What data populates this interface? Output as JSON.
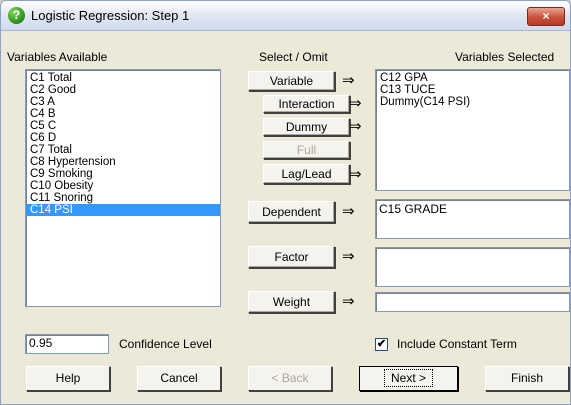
{
  "window": {
    "title": "Logistic Regression: Step 1",
    "close_glyph": "×"
  },
  "headers": {
    "variables_available": "Variables Available",
    "select_omit": "Select / Omit",
    "variables_selected": "Variables Selected"
  },
  "available_variables": [
    "C1 Total",
    "C2 Good",
    "C3 A",
    "C4 B",
    "C5 C",
    "C6 D",
    "C7 Total",
    "C8 Hypertension",
    "C9 Smoking",
    "C10 Obesity",
    "C11 Snoring",
    "C14 PSI"
  ],
  "selected_available_index": 11,
  "buttons": {
    "variable": "Variable",
    "interaction": "Interaction",
    "dummy": "Dummy",
    "full": "Full",
    "lag_lead": "Lag/Lead",
    "dependent": "Dependent",
    "factor": "Factor",
    "weight": "Weight"
  },
  "arrow_glyph": "⇒",
  "selected_variables": [
    "C12 GPA",
    "C13 TUCE",
    "Dummy(C14 PSI)"
  ],
  "dependent_value": "C15 GRADE",
  "factor_value": "",
  "weight_value": "",
  "confidence": {
    "value": "0.95",
    "label": "Confidence Level"
  },
  "constant_term": {
    "label": "Include Constant Term",
    "checked": true,
    "check_glyph": "✔"
  },
  "footer": {
    "help": "Help",
    "cancel": "Cancel",
    "back": "< Back",
    "next": "Next >",
    "finish": "Finish"
  }
}
